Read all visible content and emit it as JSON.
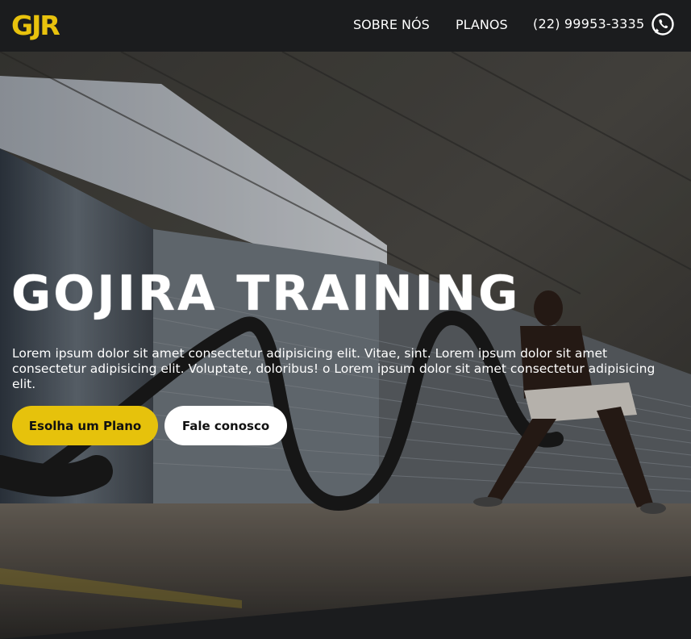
{
  "navbar": {
    "logo_text": "GJR",
    "links": {
      "about": "SOBRE NÓS",
      "plans": "PLANOS",
      "phone": "(22) 99953-3335"
    },
    "whatsapp_icon": "whatsapp-icon"
  },
  "hero": {
    "title": "GOJIRA TRAINING",
    "description": "Lorem ipsum dolor sit amet consectetur adipisicing elit. Vitae, sint. Lorem ipsum dolor sit amet consectetur adipisicing elit. Voluptate, doloribus! o Lorem ipsum dolor sit amet consectetur adipisicing elit.",
    "buttons": {
      "plan": "Esolha um Plano",
      "contact": "Fale conosco"
    }
  },
  "colors": {
    "accent": "#e6c20c",
    "navbar_bg": "#1b1c1e",
    "text": "#ffffff"
  }
}
